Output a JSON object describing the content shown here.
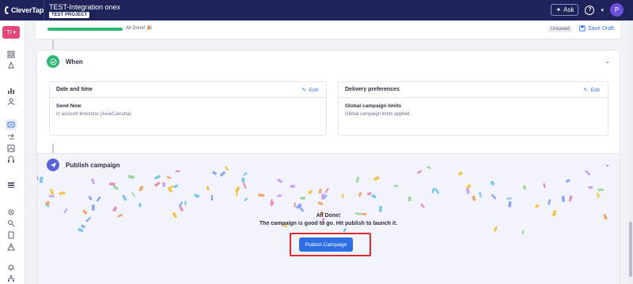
{
  "topbar": {
    "logo_text": "CleverTap",
    "account_name": "TEST-Integration onex",
    "project_chip": "TEST PROJECT",
    "ask_label": "Ask",
    "avatar_letter": "P"
  },
  "sidebar": {
    "workspace_chip": "TI",
    "icons": [
      "dashboard-icon",
      "rocket-icon",
      "analytics-icon",
      "users-icon",
      "campaign-icon",
      "journeys-icon",
      "catalog-icon",
      "support-icon",
      "library-icon",
      "settings-icon",
      "search-icon",
      "docs-icon",
      "alert-icon",
      "notification-icon",
      "org-chart-icon"
    ]
  },
  "progress": {
    "value": 1.0,
    "label": "All Done!",
    "unsaved_label": "Unsaved",
    "save_draft_label": "Save Draft"
  },
  "when": {
    "title": "When",
    "date_time": {
      "heading": "Date and time",
      "edit_label": "Edit",
      "line1": "Send Now",
      "line2": "In account timezone (Asia/Calcutta)"
    },
    "delivery": {
      "heading": "Delivery preferences",
      "edit_label": "Edit",
      "line1": "Global campaign limits",
      "line2": "Global campaign limits applied."
    }
  },
  "publish": {
    "title": "Publish campaign",
    "done_title": "All Done!",
    "done_sub": "The campaign is good to go. Hit publish to launch it.",
    "button_label": "Publish Campaign"
  },
  "colors": {
    "topbar": "#1e2459",
    "accent": "#2f6fe4",
    "success": "#2bb673",
    "highlight": "#e02a2a",
    "workspace_chip": "#e3477b"
  }
}
